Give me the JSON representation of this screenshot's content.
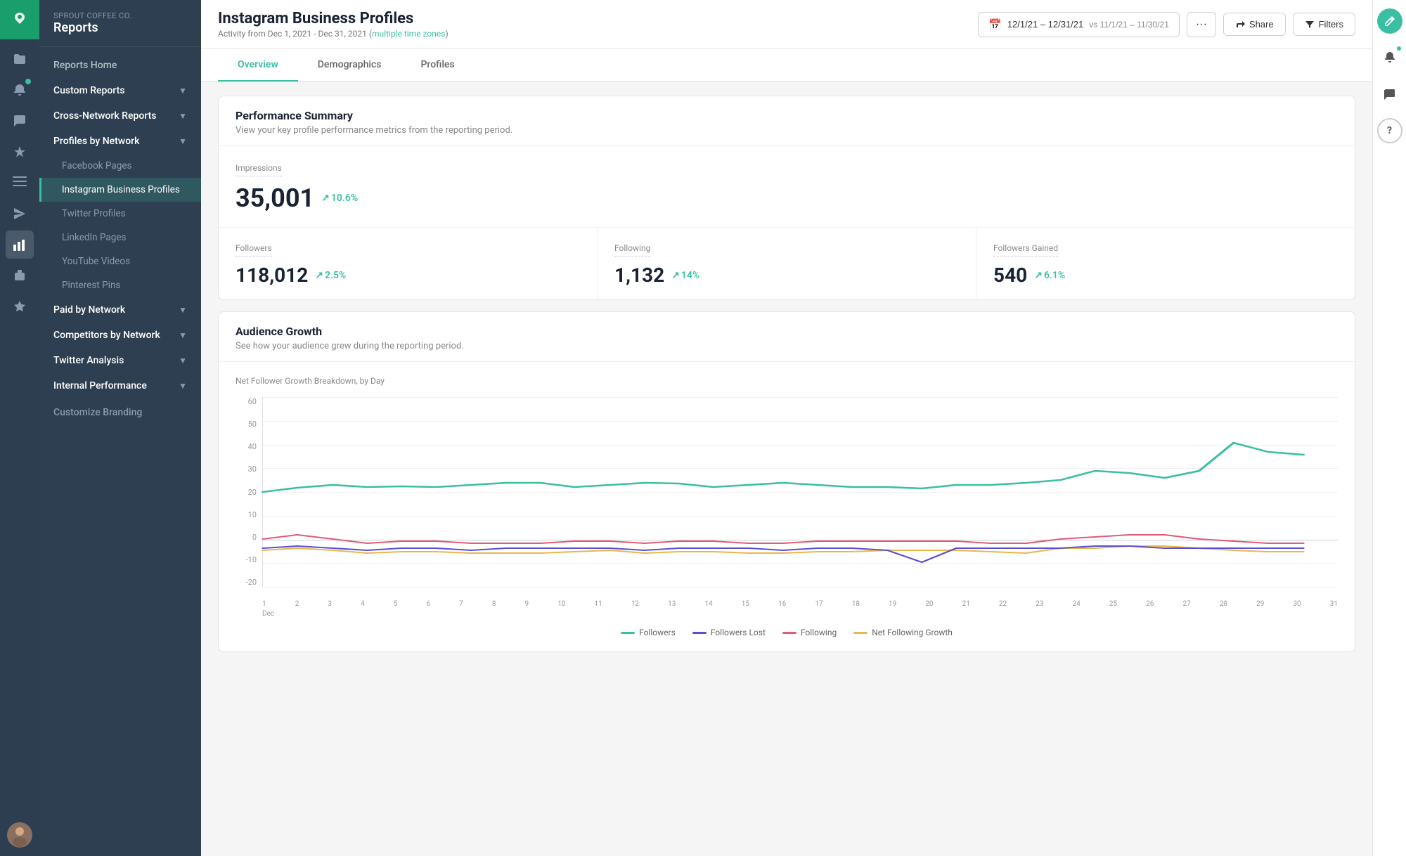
{
  "app": {
    "company": "Sprout Coffee Co.",
    "section": "Reports",
    "logo_char": "🌿"
  },
  "sidebar": {
    "nav_items": [
      {
        "id": "reports-home",
        "label": "Reports Home",
        "has_children": false,
        "expanded": false
      },
      {
        "id": "custom-reports",
        "label": "Custom Reports",
        "has_children": true,
        "expanded": false
      },
      {
        "id": "cross-network",
        "label": "Cross-Network Reports",
        "has_children": true,
        "expanded": false
      },
      {
        "id": "profiles-by-network",
        "label": "Profiles by Network",
        "has_children": true,
        "expanded": true
      }
    ],
    "profiles_sub": [
      {
        "id": "facebook",
        "label": "Facebook Pages",
        "active": false
      },
      {
        "id": "instagram",
        "label": "Instagram Business Profiles",
        "active": true
      },
      {
        "id": "twitter",
        "label": "Twitter Profiles",
        "active": false
      },
      {
        "id": "linkedin",
        "label": "LinkedIn Pages",
        "active": false
      },
      {
        "id": "youtube",
        "label": "YouTube Videos",
        "active": false
      },
      {
        "id": "pinterest",
        "label": "Pinterest Pins",
        "active": false
      }
    ],
    "more_sections": [
      {
        "id": "paid-by-network",
        "label": "Paid by Network",
        "has_children": true
      },
      {
        "id": "competitors-by-network",
        "label": "Competitors by Network",
        "has_children": true
      },
      {
        "id": "twitter-analysis",
        "label": "Twitter Analysis",
        "has_children": true
      },
      {
        "id": "internal-performance",
        "label": "Internal Performance",
        "has_children": true
      }
    ],
    "customize": "Customize Branding"
  },
  "topbar": {
    "title": "Instagram Business Profiles",
    "subtitle": "Activity from Dec 1, 2021 - Dec 31, 2021",
    "timezone": "multiple time zones",
    "date_range": "12/1/21 – 12/31/21",
    "compare_label": "vs 11/1/21 – 11/30/21",
    "share_label": "Share",
    "filters_label": "Filters",
    "more_label": "···"
  },
  "tabs": [
    {
      "id": "overview",
      "label": "Overview",
      "active": true
    },
    {
      "id": "demographics",
      "label": "Demographics",
      "active": false
    },
    {
      "id": "profiles",
      "label": "Profiles",
      "active": false
    }
  ],
  "performance_summary": {
    "title": "Performance Summary",
    "description": "View your key profile performance metrics from the reporting period.",
    "metrics": {
      "impressions": {
        "label": "Impressions",
        "value": "35,001",
        "change": "10.6%"
      },
      "followers": {
        "label": "Followers",
        "value": "118,012",
        "change": "2.5%"
      },
      "following": {
        "label": "Following",
        "value": "1,132",
        "change": "14%"
      },
      "followers_gained": {
        "label": "Followers Gained",
        "value": "540",
        "change": "6.1%"
      }
    }
  },
  "audience_growth": {
    "title": "Audience Growth",
    "description": "See how your audience grew during the reporting period.",
    "chart_label": "Net Follower Growth Breakdown, by Day",
    "y_labels": [
      "60",
      "50",
      "40",
      "30",
      "20",
      "10",
      "0",
      "-10",
      "-20"
    ],
    "x_labels": [
      "1",
      "2",
      "3",
      "4",
      "5",
      "6",
      "7",
      "8",
      "9",
      "10",
      "11",
      "12",
      "13",
      "14",
      "15",
      "16",
      "17",
      "18",
      "19",
      "20",
      "21",
      "22",
      "23",
      "24",
      "25",
      "26",
      "27",
      "28",
      "29",
      "30",
      "31"
    ],
    "x_month": "Dec",
    "legend": [
      {
        "label": "Followers",
        "color": "#3bbfa3"
      },
      {
        "label": "Followers Lost",
        "color": "#5b4fcf"
      },
      {
        "label": "Following",
        "color": "#e05a7a"
      },
      {
        "label": "Net Following Growth",
        "color": "#e8b84b"
      }
    ]
  },
  "right_rail": {
    "compose_icon": "✏",
    "bell_icon": "🔔",
    "chat_icon": "💬",
    "help_icon": "?"
  }
}
